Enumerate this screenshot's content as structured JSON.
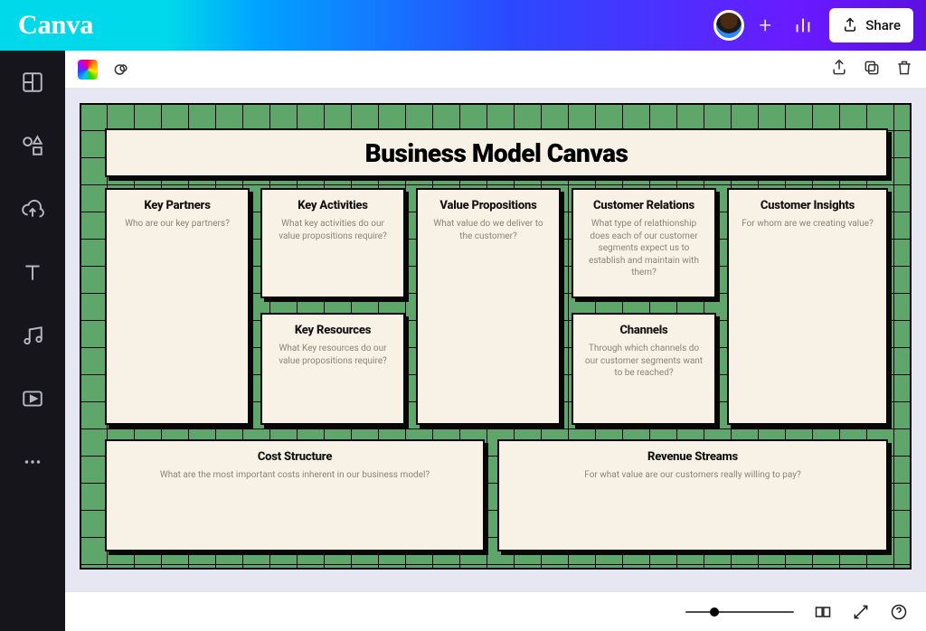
{
  "header": {
    "brand": "Canva",
    "share": "Share"
  },
  "canvas": {
    "title": "Business Model Canvas",
    "cells": {
      "kp": {
        "title": "Key Partners",
        "hint": "Who are our key partners?"
      },
      "ka": {
        "title": "Key Activities",
        "hint": "What key activities do our value propositions require?"
      },
      "kr": {
        "title": "Key Resources",
        "hint": "What Key resources do our value propositions require?"
      },
      "vp": {
        "title": "Value Propositions",
        "hint": "What value do we deliver to the customer?"
      },
      "cr": {
        "title": "Customer Relations",
        "hint": "What type of relathionship does each of our customer segments expect us to establish and maintain with them?"
      },
      "ch": {
        "title": "Channels",
        "hint": "Through which channels do our customer segments want to be reached?"
      },
      "ci": {
        "title": "Customer Insights",
        "hint": "For whom are we creating value?"
      },
      "cs": {
        "title": "Cost Structure",
        "hint": "What are the most important costs inherent in our business model?"
      },
      "rs": {
        "title": "Revenue Streams",
        "hint": "For what value are our customers really willing to pay?"
      }
    }
  }
}
